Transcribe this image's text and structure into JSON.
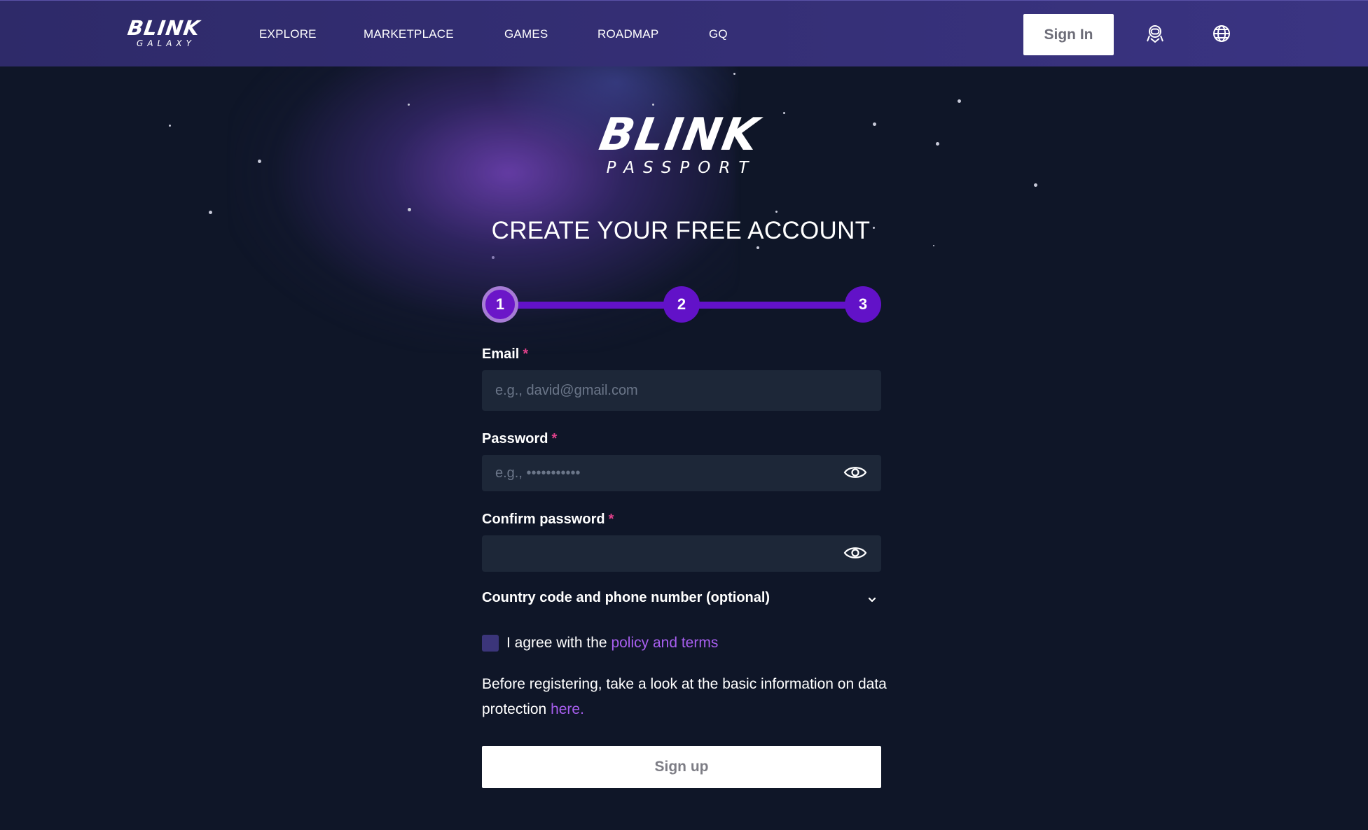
{
  "header": {
    "logo": {
      "word": "BLINK",
      "sub": "GALAXY"
    },
    "nav": [
      {
        "label": "EXPLORE"
      },
      {
        "label": "MARKETPLACE"
      },
      {
        "label": "GAMES"
      },
      {
        "label": "ROADMAP"
      },
      {
        "label": "GQ"
      }
    ],
    "sign_in_label": "Sign In",
    "icons": [
      "astronaut-icon",
      "globe-icon"
    ]
  },
  "main": {
    "logo": {
      "word": "BLINK",
      "sub": "PASSPORT"
    },
    "title": "CREATE YOUR FREE ACCOUNT",
    "steps": {
      "labels": [
        "1",
        "2",
        "3"
      ],
      "current": 1
    },
    "email": {
      "label": "Email",
      "required_mark": "*",
      "placeholder": "e.g., david@gmail.com",
      "value": ""
    },
    "password": {
      "label": "Password",
      "required_mark": "*",
      "placeholder": "e.g., •••••••••••",
      "value": ""
    },
    "confirm_password": {
      "label": "Confirm password",
      "required_mark": "*",
      "placeholder": "",
      "value": ""
    },
    "phone": {
      "label": "Country code and phone number (optional)",
      "expanded": false
    },
    "agree": {
      "prefix": "I agree with the",
      "link": "policy and terms",
      "checked": false
    },
    "info": {
      "text": "Before registering, take a look at the basic information on data protection",
      "link": "here."
    },
    "signup_label": "Sign up"
  },
  "colors": {
    "header_bg": "#352f76",
    "page_bg": "#0f1628",
    "accent": "#6212c8",
    "link": "#a85ff0",
    "required": "#e0418b",
    "input_bg": "#1d2738"
  }
}
